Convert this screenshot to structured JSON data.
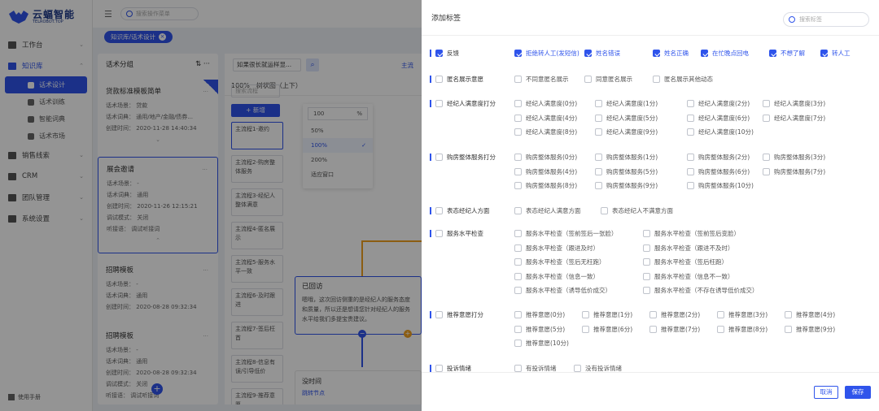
{
  "brand": {
    "name": "云蝠智能",
    "sub": "TELROBOT.TOP"
  },
  "nav": [
    {
      "label": "工作台",
      "arrow": "⌄"
    },
    {
      "label": "知识库",
      "arrow": "⌃"
    },
    {
      "label": "话术设计"
    },
    {
      "label": "话术训练"
    },
    {
      "label": "智能词典"
    },
    {
      "label": "话术市场"
    },
    {
      "label": "销售线索",
      "arrow": "⌄"
    },
    {
      "label": "CRM",
      "arrow": "⌄"
    },
    {
      "label": "团队管理",
      "arrow": "⌄"
    },
    {
      "label": "系统设置",
      "arrow": "⌄"
    }
  ],
  "manual": "使用手册",
  "topbar": {
    "search_placeholder": "搜索操作菜单"
  },
  "breadcrumb": {
    "tag": "知识库/话术设计",
    "close": "×"
  },
  "script_col": {
    "title": "话术分组",
    "cards": [
      {
        "title": "贷款标准模板简单",
        "l1": "话术场景：  贷款",
        "l2": "话术词典：  通用/地产/金融/债券...",
        "l3": "创建时间：  2020-11-28 14:40:34"
      },
      {
        "title": "展会邀请",
        "l1": "话术场景：  -",
        "l2": "话术词典：  通用",
        "l3": "创建时间：  2020-11-26 12:15:21",
        "l4": "调试模式：  关闭",
        "l5": "听接语：    调试听接词"
      },
      {
        "title": "招聘模板",
        "l1": "话术场景：  -",
        "l2": "话术词典：  通用",
        "l3": "创建时间：  2020-08-28 09:32:34"
      },
      {
        "title": "招聘模板",
        "l1": "话术场景：  -",
        "l2": "话术词典：  通用",
        "l3": "创建时间：  2020-08-28 09:32:34",
        "l4": "调试模式：  关闭",
        "l5": "听接语：    调试听接词"
      }
    ]
  },
  "flow": {
    "select": "如果很长就运样显...",
    "link": "主流",
    "zoom": "100%",
    "tree": "树状图（上下）",
    "proc_search": "搜索流程",
    "proc_add": "+ 新增",
    "procs": [
      "主流程1-邀约",
      "主流程2-购房整体服务",
      "主流程3-经纪人整体满意",
      "主流程4-匿名展示",
      "主流程5-服务水平一致",
      "主流程6-及时跟进",
      "主流程7-签后枉首",
      "主流程8-信息有误/引导低价",
      "主流程9-推荐意愿"
    ],
    "zoom_input": "100",
    "zoom_unit": "%",
    "zoom_opts": [
      "50%",
      "100%",
      "200%",
      "适应窗口"
    ],
    "node_title": "已回访",
    "node_text": "嗯哦，这次回访侧重的是经纪人的服务态度和质量，所以还是想请您针对经纪人的服务水平给我们多提宝贵建议。",
    "node2_title": "没时间",
    "node2_link": "跳转节点"
  },
  "drawer": {
    "title": "添加标签",
    "search_placeholder": "搜索标签",
    "groups": [
      {
        "name": "反馈",
        "checked": true,
        "options": [
          {
            "label": "拒绝转人工(发短信)",
            "checked": true
          },
          {
            "label": "姓名错误",
            "checked": true
          },
          {
            "label": "姓名正确",
            "checked": true
          },
          {
            "label": "在忙晚点回电",
            "checked": true
          },
          {
            "label": "不想了解",
            "checked": true
          },
          {
            "label": "转人工",
            "checked": true
          }
        ]
      },
      {
        "name": "匿名展示意愿",
        "checked": false,
        "options": [
          {
            "label": "不同意匿名展示"
          },
          {
            "label": "同意匿名展示"
          },
          {
            "label": "匿名展示其他动态"
          }
        ]
      },
      {
        "name": "经纪人满意度打分",
        "checked": false,
        "options": [
          {
            "label": "经纪人满意度(0分)"
          },
          {
            "label": "经纪人满意度(1分)"
          },
          {
            "label": "经纪人满意度(2分)"
          },
          {
            "label": "经纪人满意度(3分)"
          },
          {
            "label": "经纪人满意度(4分)"
          },
          {
            "label": "经纪人满意度(5分)"
          },
          {
            "label": "经纪人满意度(6分)"
          },
          {
            "label": "经纪人满意度(7分)"
          },
          {
            "label": "经纪人满意度(8分)"
          },
          {
            "label": "经纪人满意度(9分)"
          },
          {
            "label": "经纪人满意度(10分)"
          }
        ]
      },
      {
        "name": "购房整体服务打分",
        "checked": false,
        "options": [
          {
            "label": "购房整体服务(0分)"
          },
          {
            "label": "购房整体服务(1分)"
          },
          {
            "label": "购房整体服务(2分)"
          },
          {
            "label": "购房整体服务(3分)"
          },
          {
            "label": "购房整体服务(4分)"
          },
          {
            "label": "购房整体服务(5分)"
          },
          {
            "label": "购房整体服务(6分)"
          },
          {
            "label": "购房整体服务(7分)"
          },
          {
            "label": "购房整体服务(8分)"
          },
          {
            "label": "购房整体服务(9分)"
          },
          {
            "label": "购房整体服务(10分)"
          }
        ]
      },
      {
        "name": "表态经纪人方面",
        "checked": false,
        "options": [
          {
            "label": "表态经纪人满意方面"
          },
          {
            "label": "表态经纪人不满意方面"
          }
        ]
      },
      {
        "name": "服务水平检查",
        "checked": false,
        "options": [
          {
            "label": "服务水平检查（签前签后一张脸）"
          },
          {
            "label": "服务水平检查（签前签后变脸）"
          },
          {
            "label": "服务水平检查（跟进及时）"
          },
          {
            "label": "服务水平检查（跟进不及时）"
          },
          {
            "label": "服务水平检查（签后无枉跑）"
          },
          {
            "label": "服务水平检查（签后枉跑）"
          },
          {
            "label": "服务水平检查（信息一致）"
          },
          {
            "label": "服务水平检查（信息不一致）"
          },
          {
            "label": "服务水平检查（诱导低价成交）"
          },
          {
            "label": "服务水平检查（不存在诱导低价成交）"
          }
        ]
      },
      {
        "name": "推荐意愿打分",
        "checked": false,
        "options": [
          {
            "label": "推荐意愿(0分)"
          },
          {
            "label": "推荐意愿(1分)"
          },
          {
            "label": "推荐意愿(2分)"
          },
          {
            "label": "推荐意愿(3分)"
          },
          {
            "label": "推荐意愿(4分)"
          },
          {
            "label": "推荐意愿(5分)"
          },
          {
            "label": "推荐意愿(6分)"
          },
          {
            "label": "推荐意愿(7分)"
          },
          {
            "label": "推荐意愿(8分)"
          },
          {
            "label": "推荐意愿(9分)"
          },
          {
            "label": "推荐意愿(10分)"
          }
        ]
      },
      {
        "name": "投诉情绪",
        "checked": false,
        "options": [
          {
            "label": "有投诉情绪"
          },
          {
            "label": "没有投诉情绪"
          }
        ]
      }
    ],
    "cancel": "取消",
    "save": "保存"
  }
}
